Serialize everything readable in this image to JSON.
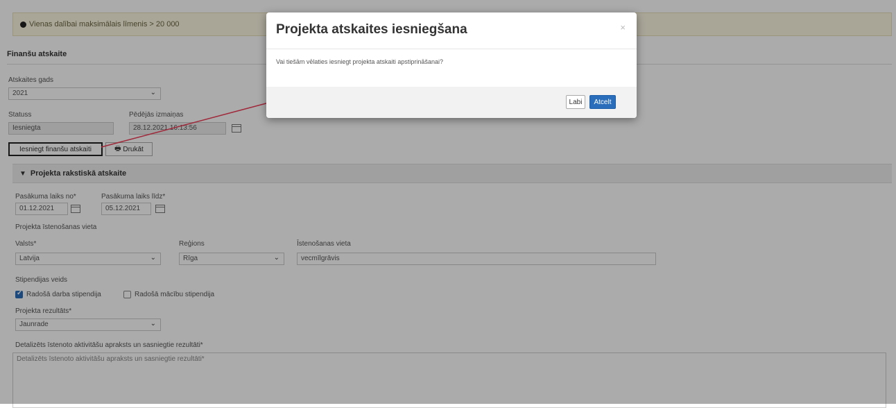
{
  "info_bar": {
    "text": "Vienas dalībai maksimālais līmenis > 20 000"
  },
  "section_title": "Finanšu atskaite",
  "report_year": {
    "label": "Atskaites gads",
    "value": "2021"
  },
  "status": {
    "label": "Statuss",
    "value": "Iesniegta"
  },
  "last_change": {
    "label": "Pēdējās izmaiņas",
    "value": "28.12.2021 16:13:56"
  },
  "buttons": {
    "submit_financial": "Iesniegt finanšu atskaiti",
    "print": "Drukāt"
  },
  "panel": {
    "title": "Projekta rakstiskā atskaite"
  },
  "event_from": {
    "label": "Pasākuma laiks no*",
    "value": "01.12.2021"
  },
  "event_to": {
    "label": "Pasākuma laiks līdz*",
    "value": "05.12.2021"
  },
  "location_group_label": "Projekta īstenošanas vieta",
  "country": {
    "label": "Valsts*",
    "value": "Latvija"
  },
  "region": {
    "label": "Reģions",
    "value": "Rīga"
  },
  "place": {
    "label": "Īstenošanas vieta",
    "value": "vecmīlgrāvis"
  },
  "stipend_type": {
    "label": "Stipendijas veids",
    "options": [
      {
        "label": "Radošā darba stipendija",
        "checked": true
      },
      {
        "label": "Radošā mācību stipendija",
        "checked": false
      }
    ]
  },
  "project_result": {
    "label": "Projekta rezultāts*",
    "value": "Jaunrade"
  },
  "description": {
    "label": "Detalizēts īstenoto aktivitāšu apraksts un sasniegtie rezultāti*",
    "placeholder": "Detalizēts īstenoto aktivitāšu apraksts un sasniegtie rezultāti*"
  },
  "modal": {
    "title": "Projekta atskaites iesniegšana",
    "close": "×",
    "body": "Vai tiešām vēlaties iesniegt projekta atskaiti apstiprināšanai?",
    "cancel": "Labi",
    "ok": "Atcelt"
  },
  "colors": {
    "primary": "#2a6ebb",
    "arrow": "#a0283a",
    "info_bg": "#fcf8e3"
  }
}
